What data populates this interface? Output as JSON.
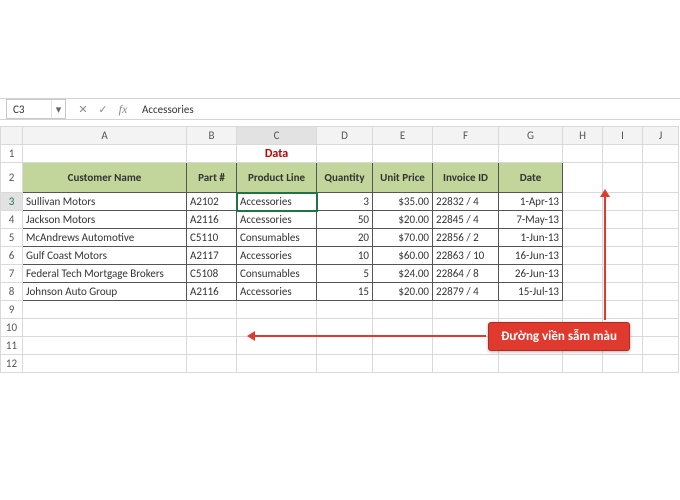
{
  "nameBox": {
    "ref": "C3"
  },
  "formulaBar": {
    "value": "Accessories",
    "fxLabel": "fx"
  },
  "columns": [
    "A",
    "B",
    "C",
    "D",
    "E",
    "F",
    "G",
    "H",
    "I",
    "J"
  ],
  "rowNumbers": [
    "1",
    "2",
    "3",
    "4",
    "5",
    "6",
    "7",
    "8",
    "9",
    "10",
    "11",
    "12"
  ],
  "title": "Data",
  "headers": {
    "A": "Customer Name",
    "B": "Part  #",
    "C": "Product Line",
    "D": "Quantity",
    "E": "Unit Price",
    "F": "Invoice ID",
    "G": "Date"
  },
  "rows": [
    {
      "A": "Sullivan Motors",
      "B": "A2102",
      "C": "Accessories",
      "D": "3",
      "E": "$35.00",
      "F": "22832 / 4",
      "G": "1-Apr-13"
    },
    {
      "A": "Jackson Motors",
      "B": "A2116",
      "C": "Accessories",
      "D": "50",
      "E": "$20.00",
      "F": "22845 / 4",
      "G": "7-May-13"
    },
    {
      "A": "McAndrews Automotive",
      "B": "C5110",
      "C": "Consumables",
      "D": "20",
      "E": "$70.00",
      "F": "22856 / 2",
      "G": "1-Jun-13"
    },
    {
      "A": "Gulf Coast Motors",
      "B": "A2117",
      "C": "Accessories",
      "D": "10",
      "E": "$60.00",
      "F": "22863 / 10",
      "G": "16-Jun-13"
    },
    {
      "A": "Federal Tech Mortgage Brokers",
      "B": "C5108",
      "C": "Consumables",
      "D": "5",
      "E": "$24.00",
      "F": "22864 / 8",
      "G": "26-Jun-13"
    },
    {
      "A": "Johnson Auto Group",
      "B": "A2116",
      "C": "Accessories",
      "D": "15",
      "E": "$20.00",
      "F": "22879 / 4",
      "G": "15-Jul-13"
    }
  ],
  "callout": {
    "text": "Đường viền sẫm màu"
  },
  "activeCell": "C3"
}
